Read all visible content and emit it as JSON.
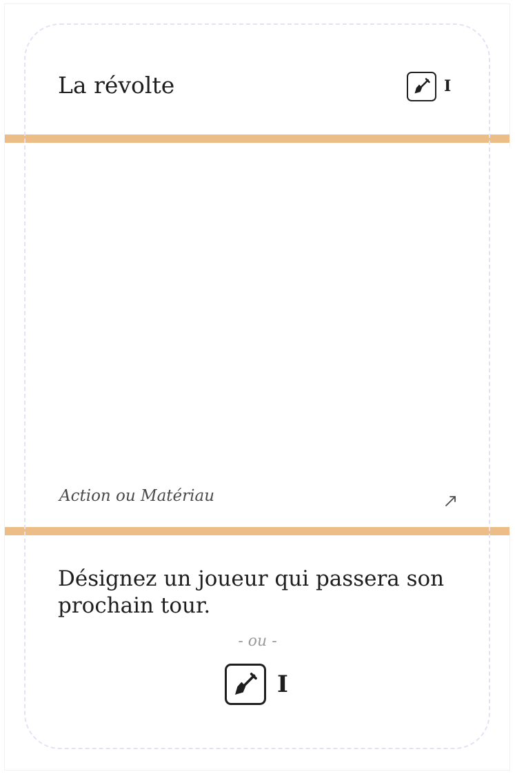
{
  "card": {
    "title": "La révolte",
    "cost": {
      "icon": "shovel-icon",
      "value": "I"
    },
    "type_label": "Action ou Matériau",
    "type_icon": "arrow-up-right-icon",
    "effect": "Désignez un joueur qui passera son prochain tour.",
    "separator": "- ou -",
    "alt_cost": {
      "icon": "shovel-icon",
      "value": "I"
    }
  },
  "colors": {
    "band": "#ecbd86",
    "text": "#1e1e1e",
    "muted": "#9a9a9a",
    "guide": "#e2e2f6"
  }
}
